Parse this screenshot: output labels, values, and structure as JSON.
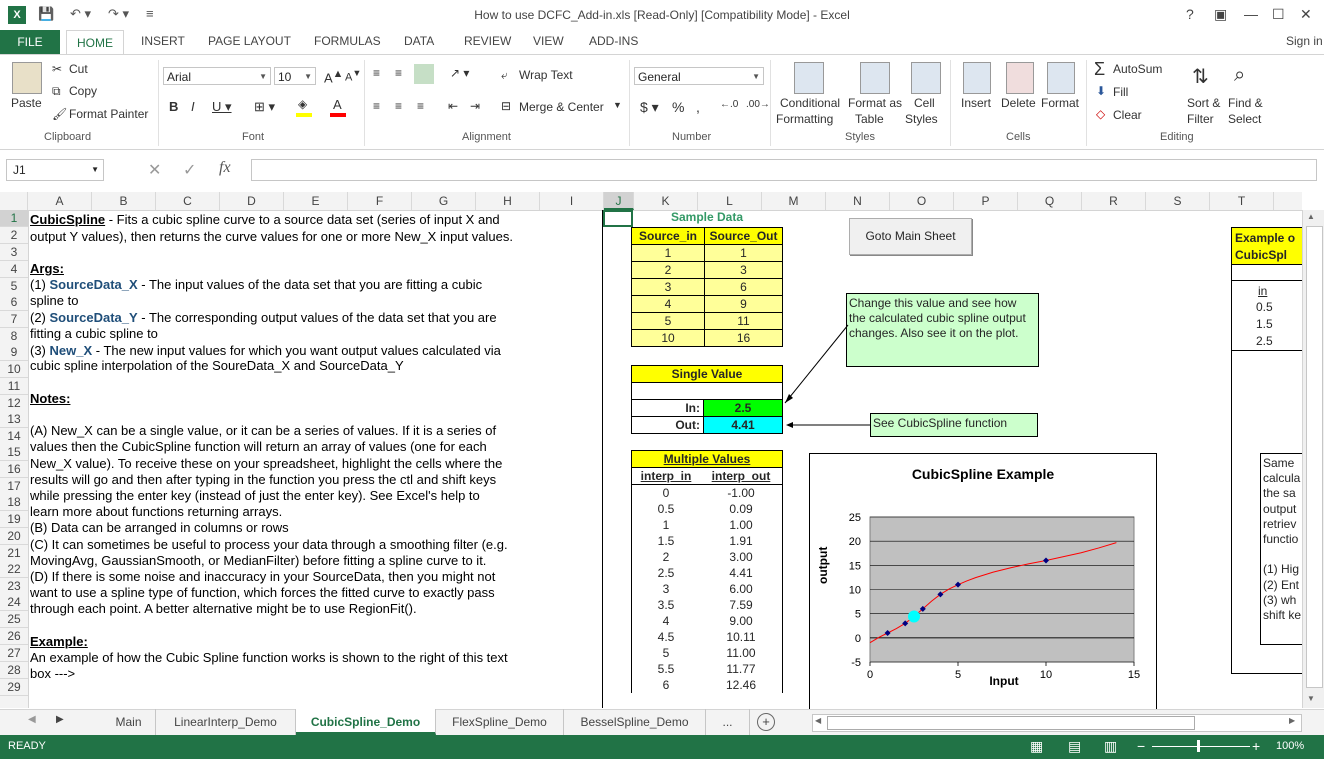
{
  "window": {
    "title": "How to use DCFC_Add-in.xls  [Read-Only]  [Compatibility Mode] - Excel",
    "sign_in": "Sign in"
  },
  "menu": {
    "file": "FILE",
    "tabs": [
      "HOME",
      "INSERT",
      "PAGE LAYOUT",
      "FORMULAS",
      "DATA",
      "REVIEW",
      "VIEW",
      "ADD-INS"
    ]
  },
  "ribbon": {
    "clipboard": {
      "paste": "Paste",
      "cut": "Cut",
      "copy": "Copy",
      "format_painter": "Format Painter",
      "label": "Clipboard"
    },
    "font": {
      "name": "Arial",
      "size": "10",
      "label": "Font"
    },
    "alignment": {
      "wrap_text": "Wrap Text",
      "merge_center": "Merge & Center",
      "label": "Alignment"
    },
    "number": {
      "format": "General",
      "label": "Number"
    },
    "styles": {
      "conditional": "Conditional",
      "formatting": "Formatting",
      "format_as": "Format as",
      "table": "Table",
      "cell": "Cell",
      "cell_styles": "Styles",
      "label": "Styles"
    },
    "cells": {
      "insert": "Insert",
      "delete": "Delete",
      "format": "Format",
      "label": "Cells"
    },
    "editing": {
      "autosum": "AutoSum",
      "fill": "Fill",
      "clear": "Clear",
      "sort": "Sort &",
      "filter": "Filter",
      "find": "Find &",
      "select": "Select",
      "label": "Editing"
    }
  },
  "formula_bar": {
    "name_box": "J1",
    "fx": "fx",
    "value": ""
  },
  "columns": [
    "A",
    "B",
    "C",
    "D",
    "E",
    "F",
    "G",
    "H",
    "I",
    "J",
    "K",
    "L",
    "M",
    "N",
    "O",
    "P",
    "Q",
    "R",
    "S",
    "T"
  ],
  "rows": [
    "1",
    "2",
    "3",
    "4",
    "5",
    "6",
    "7",
    "8",
    "9",
    "10",
    "11",
    "12",
    "13",
    "14",
    "15",
    "16",
    "17",
    "18",
    "19",
    "20",
    "21",
    "22",
    "23",
    "24",
    "25",
    "26",
    "27",
    "28",
    "29"
  ],
  "text_box": {
    "l1a": "CubicSpline",
    "l1b": " - Fits a cubic spline curve to a source data set (series of input X and",
    "l2": "output Y values), then returns the curve values for one or more New_X input values.",
    "args": "Args:",
    "a1n": "(1) ",
    "a1k": "SourceData_X",
    "a1t": " - The input values of the data set that you are fitting a cubic",
    "a1c": "spline to",
    "a2n": "(2) ",
    "a2k": "SourceData_Y",
    "a2t": " - The corresponding output values of the data set that you are",
    "a2c": "fitting a cubic spline to",
    "a3n": "(3) ",
    "a3k": "New_X",
    "a3t": " - The new input values for which you want output values calculated via",
    "a3c": "cubic spline interpolation of the SoureData_X and SourceData_Y",
    "notes": "Notes:",
    "n1": "(A) New_X can be a single value, or it can be a series of values.  If it is a series of",
    "n2": "values then the CubicSpline function will return an array of values (one for each",
    "n3": "New_X value).  To receive these on your spreadsheet, highlight the cells where the",
    "n4": "results will go and then after typing in the function you press the ctl and shift keys",
    "n5": "while pressing the enter key (instead of just the enter key).  See Excel's help to",
    "n6": "learn more about functions returning arrays.",
    "n7": "(B) Data can be arranged in columns or rows",
    "n8": "(C) It can sometimes be useful to process your data through a smoothing filter (e.g.",
    "n9": "MovingAvg, GaussianSmooth, or MedianFilter) before fitting a spline curve to it.",
    "n10": "(D) If there is some noise and inaccuracy in your SourceData, then you might not",
    "n11": "want to use a spline type of function, which forces the fitted curve to exactly pass",
    "n12": "through each point.  A better alternative might be to use RegionFit().",
    "example": "Example:",
    "e1": "An example of how the Cubic Spline function works is shown to the right of this text",
    "e2": "box --->"
  },
  "sample": {
    "title": "Sample Data",
    "h_in": "Source_in",
    "h_out": "Source_Out",
    "rows": [
      [
        "1",
        "1"
      ],
      [
        "2",
        "3"
      ],
      [
        "3",
        "6"
      ],
      [
        "4",
        "9"
      ],
      [
        "5",
        "11"
      ],
      [
        "10",
        "16"
      ]
    ]
  },
  "single": {
    "title": "Single Value",
    "in_label": "In:",
    "in_val": "2.5",
    "out_label": "Out:",
    "out_val": "4.41"
  },
  "multiple": {
    "title": "Multiple Values",
    "h_in": "interp_in",
    "h_out": "interp_out",
    "rows": [
      [
        "0",
        "-1.00"
      ],
      [
        "0.5",
        "0.09"
      ],
      [
        "1",
        "1.00"
      ],
      [
        "1.5",
        "1.91"
      ],
      [
        "2",
        "3.00"
      ],
      [
        "2.5",
        "4.41"
      ],
      [
        "3",
        "6.00"
      ],
      [
        "3.5",
        "7.59"
      ],
      [
        "4",
        "9.00"
      ],
      [
        "4.5",
        "10.11"
      ],
      [
        "5",
        "11.00"
      ],
      [
        "5.5",
        "11.77"
      ],
      [
        "6",
        "12.46"
      ]
    ]
  },
  "goto_button": "Goto Main Sheet",
  "callout_change": "Change this value and see how the calculated cubic spline output changes.  Also see it on the plot.",
  "callout_see": "See CubicSpline function",
  "right_panel": {
    "title1": "Example o",
    "title2": "CubicSpl",
    "h": "in",
    "vals": [
      "0.5",
      "1.5",
      "2.5"
    ],
    "note": [
      "Same",
      "calcula",
      "the sa",
      "output",
      "retriev",
      "functio",
      "",
      "(1) Hig",
      "(2) Ent",
      "(3) wh",
      "shift ke"
    ]
  },
  "chart_data": {
    "type": "scatter",
    "title": "CubicSpline Example",
    "xlabel": "Input",
    "ylabel": "output",
    "xlim": [
      0,
      15
    ],
    "ylim": [
      -5,
      25
    ],
    "xticks": [
      "0",
      "5",
      "10",
      "15"
    ],
    "yticks": [
      "-5",
      "0",
      "5",
      "10",
      "15",
      "20",
      "25"
    ],
    "grid": true,
    "series": [
      {
        "points": [
          [
            1,
            1
          ],
          [
            2,
            3
          ],
          [
            3,
            6
          ],
          [
            4,
            9
          ],
          [
            5,
            11
          ],
          [
            10,
            16
          ]
        ],
        "marker": "diamond",
        "color": "#000080"
      },
      {
        "points": [
          [
            2.5,
            4.41
          ]
        ],
        "marker": "circle",
        "color": "#00ffff"
      },
      {
        "line": [
          [
            0,
            -1
          ],
          [
            0.5,
            0.09
          ],
          [
            1,
            1
          ],
          [
            1.5,
            1.91
          ],
          [
            2,
            3
          ],
          [
            2.5,
            4.41
          ],
          [
            3,
            6
          ],
          [
            3.5,
            7.59
          ],
          [
            4,
            9
          ],
          [
            4.5,
            10.11
          ],
          [
            5,
            11
          ],
          [
            5.5,
            11.77
          ],
          [
            6,
            12.46
          ],
          [
            7,
            13.6
          ],
          [
            8,
            14.5
          ],
          [
            9,
            15.3
          ],
          [
            10,
            16
          ],
          [
            11,
            16.8
          ],
          [
            12,
            17.6
          ],
          [
            13,
            18.6
          ],
          [
            14,
            19.7
          ]
        ],
        "color": "#ff0000"
      }
    ]
  },
  "sheet_tabs": [
    "Main",
    "LinearInterp_Demo",
    "CubicSpline_Demo",
    "FlexSpline_Demo",
    "BesselSpline_Demo",
    "..."
  ],
  "status": {
    "ready": "READY",
    "zoom": "100%"
  }
}
